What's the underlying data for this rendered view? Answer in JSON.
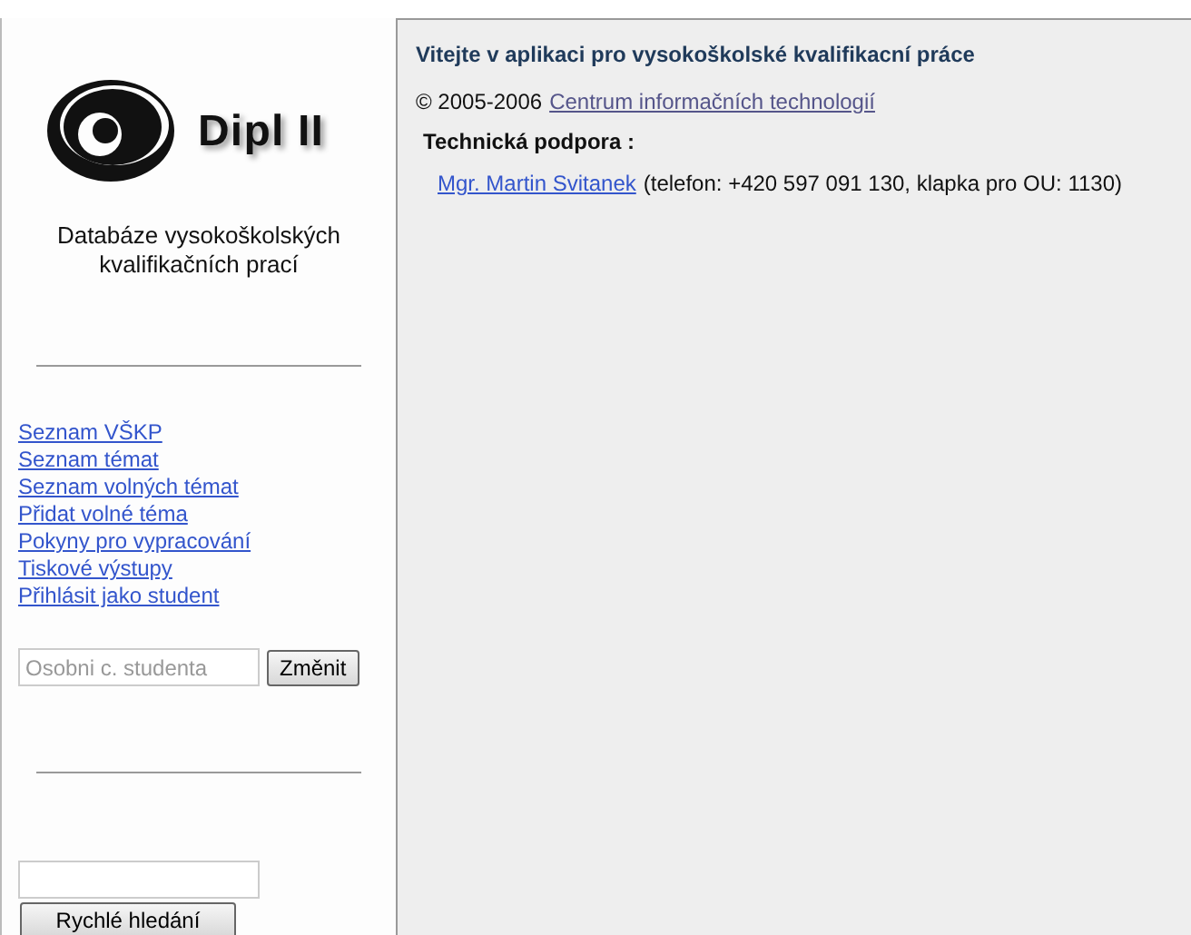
{
  "sidebar": {
    "logo_text": "Dipl II",
    "subtitle": "Databáze vysokoškolských kvalifikačních prací",
    "links": [
      {
        "label": "Seznam VŠKP"
      },
      {
        "label": "Seznam témat"
      },
      {
        "label": "Seznam volných témat"
      },
      {
        "label": "Přidat volné téma"
      },
      {
        "label": "Pokyny pro vypracování"
      },
      {
        "label": "Tiskové výstupy"
      },
      {
        "label": "Přihlásit jako student"
      }
    ],
    "student_field": {
      "placeholder": "Osobni c. studenta"
    },
    "change_button": "Změnit",
    "quick_search_button": "Rychlé hledání"
  },
  "main": {
    "title": "Vitejte v aplikaci pro vysokoškolské kvalifikacní práce",
    "copyright": "© 2005-2006",
    "copyright_link": "Centrum informačních technologií",
    "support_heading": "Technická podpora :",
    "contact_link": "Mgr. Martin Svitanek",
    "contact_text": "(telefon: +420 597 091 130, klapka pro OU: 1130)"
  }
}
